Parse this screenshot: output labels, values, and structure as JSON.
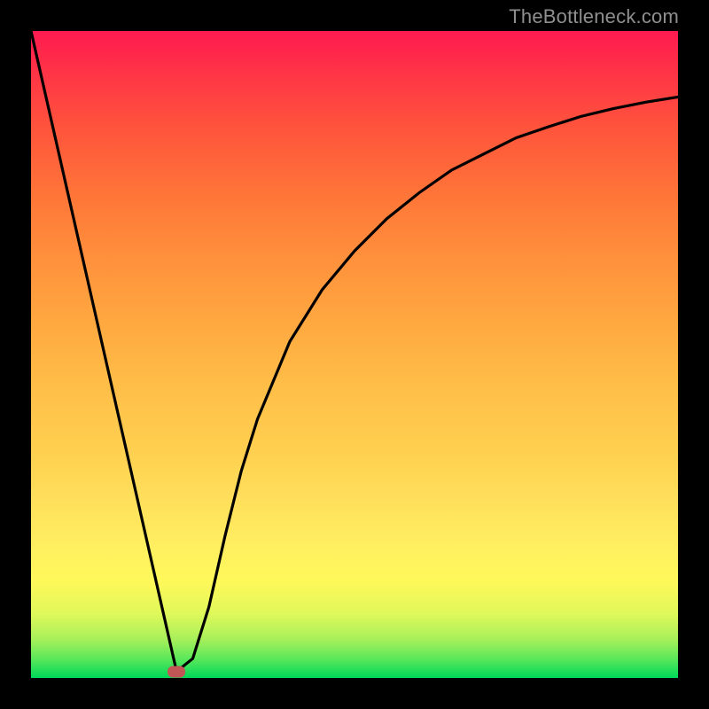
{
  "watermark": "TheBottleneck.com",
  "colors": {
    "background": "#000000",
    "gradient_top": "#ff1a50",
    "gradient_bottom": "#00d85a",
    "curve": "#000000",
    "marker": "#c25555"
  },
  "chart_data": {
    "type": "line",
    "title": "",
    "xlabel": "",
    "ylabel": "",
    "xlim": [
      0,
      100
    ],
    "ylim": [
      0,
      100
    ],
    "series": [
      {
        "name": "curve",
        "x": [
          0,
          5,
          10,
          15,
          20,
          22.5,
          25,
          27.5,
          30,
          32.5,
          35,
          40,
          45,
          50,
          55,
          60,
          65,
          70,
          75,
          80,
          85,
          90,
          95,
          100
        ],
        "y": [
          100,
          78,
          56,
          34,
          12,
          1,
          3,
          11,
          22,
          32,
          40,
          52,
          60,
          66,
          71,
          75,
          78.5,
          81,
          83.5,
          85.2,
          86.8,
          88,
          89,
          89.8
        ]
      }
    ],
    "marker": {
      "x": 22.5,
      "y": 1
    }
  }
}
